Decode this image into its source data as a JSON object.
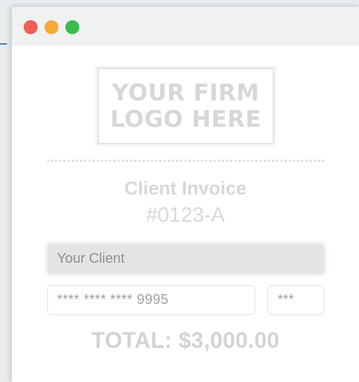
{
  "window": {
    "controls": [
      "close",
      "minimize",
      "maximize"
    ],
    "colors": {
      "close": "#ee5d57",
      "minimize": "#f5a937",
      "maximize": "#3dbb4d"
    }
  },
  "logo": {
    "line1": "YOUR FIRM",
    "line2": "LOGO HERE"
  },
  "invoice": {
    "title": "Client Invoice",
    "number": "#0123-A"
  },
  "form": {
    "client_placeholder": "Your Client",
    "card_placeholder": "**** **** **** 9995",
    "cvv_placeholder": "***"
  },
  "total": "TOTAL: $3,000.00"
}
